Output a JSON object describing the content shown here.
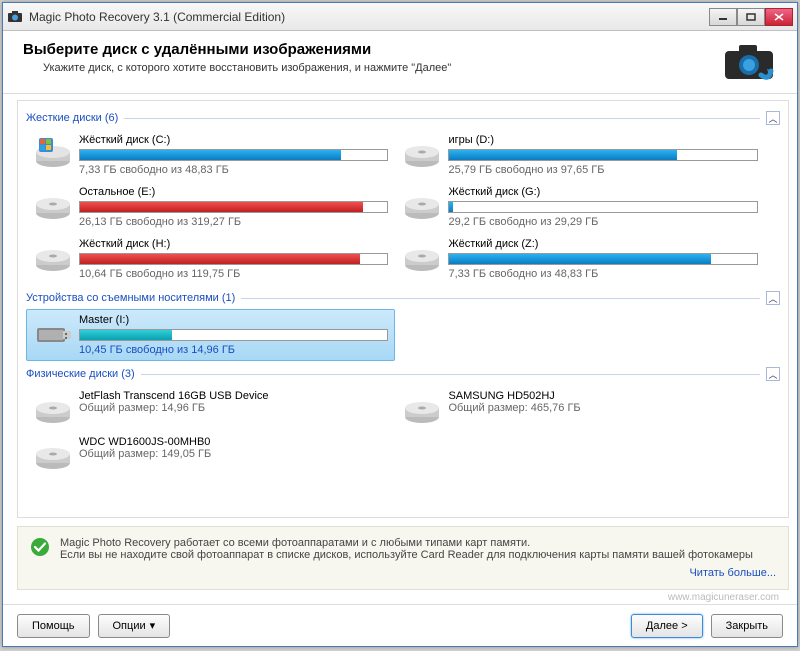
{
  "window": {
    "title": "Magic Photo Recovery 3.1 (Commercial Edition)"
  },
  "header": {
    "title": "Выберите диск с удалёнными изображениями",
    "subtitle": "Укажите диск, с которого хотите восстановить изображения, и нажмите \"Далее\""
  },
  "groups": {
    "hdd": {
      "label": "Жесткие диски (6)"
    },
    "removable": {
      "label": "Устройства со съемными носителями (1)"
    },
    "physical": {
      "label": "Физические диски (3)"
    }
  },
  "hdd": [
    {
      "name": "Жёсткий диск (C:)",
      "stat": "7,33 ГБ свободно из 48,83 ГБ",
      "pct": 85,
      "color": "blue",
      "type": "win"
    },
    {
      "name": "игры (D:)",
      "stat": "25,79 ГБ свободно из 97,65 ГБ",
      "pct": 74,
      "color": "blue",
      "type": "hdd"
    },
    {
      "name": "Остальное (E:)",
      "stat": "26,13 ГБ свободно из 319,27 ГБ",
      "pct": 92,
      "color": "red",
      "type": "hdd"
    },
    {
      "name": "Жёсткий диск (G:)",
      "stat": "29,2 ГБ свободно из 29,29 ГБ",
      "pct": 1,
      "color": "blue",
      "type": "hdd"
    },
    {
      "name": "Жёсткий диск (H:)",
      "stat": "10,64 ГБ свободно из 119,75 ГБ",
      "pct": 91,
      "color": "red",
      "type": "hdd"
    },
    {
      "name": "Жёсткий диск (Z:)",
      "stat": "7,33 ГБ свободно из 48,83 ГБ",
      "pct": 85,
      "color": "blue",
      "type": "hdd"
    }
  ],
  "removable": [
    {
      "name": "Master (I:)",
      "stat": "10,45 ГБ свободно из 14,96 ГБ",
      "pct": 30,
      "color": "cyan",
      "type": "usb",
      "selected": true
    }
  ],
  "physical": [
    {
      "name": "JetFlash Transcend 16GB USB Device",
      "stat": "Общий размер: 14,96 ГБ"
    },
    {
      "name": "SAMSUNG HD502HJ",
      "stat": "Общий размер: 465,76 ГБ"
    },
    {
      "name": "WDC WD1600JS-00MHB0",
      "stat": "Общий размер: 149,05 ГБ"
    }
  ],
  "info": {
    "text": "Magic Photo Recovery работает со всеми фотоаппаратами и с любыми типами карт памяти.\nЕсли вы не находите свой фотоаппарат в списке дисков, используйте Card Reader для подключения карты памяти вашей фотокамеры",
    "more": "Читать больше..."
  },
  "source_link": "www.magicuneraser.com",
  "buttons": {
    "help": "Помощь",
    "options": "Опции",
    "next": "Далее >",
    "close": "Закрыть"
  }
}
